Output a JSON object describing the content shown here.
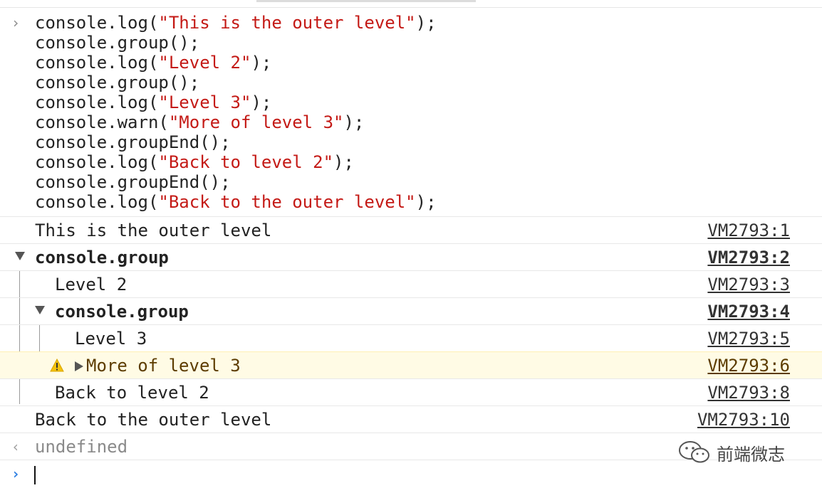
{
  "input": {
    "prompt_icon": "chevron-right-icon",
    "lines": [
      {
        "pre": "console.log(",
        "str": "\"This is the outer level\"",
        "post": ");"
      },
      {
        "pre": "console.group();",
        "str": "",
        "post": ""
      },
      {
        "pre": "console.log(",
        "str": "\"Level 2\"",
        "post": ");"
      },
      {
        "pre": "console.group();",
        "str": "",
        "post": ""
      },
      {
        "pre": "console.log(",
        "str": "\"Level 3\"",
        "post": ");"
      },
      {
        "pre": "console.warn(",
        "str": "\"More of level 3\"",
        "post": ");"
      },
      {
        "pre": "console.groupEnd();",
        "str": "",
        "post": ""
      },
      {
        "pre": "console.log(",
        "str": "\"Back to level 2\"",
        "post": ");"
      },
      {
        "pre": "console.groupEnd();",
        "str": "",
        "post": ""
      },
      {
        "pre": "console.log(",
        "str": "\"Back to the outer level\"",
        "post": ");"
      }
    ]
  },
  "messages": [
    {
      "text": "This is the outer level",
      "source": "VM2793:1"
    },
    {
      "text": "console.group",
      "source": "VM2793:2",
      "expand_icon": "triangle-down-icon"
    },
    {
      "text": "Level 2",
      "source": "VM2793:3"
    },
    {
      "text": "console.group",
      "source": "VM2793:4",
      "expand_icon": "triangle-down-icon"
    },
    {
      "text": "Level 3",
      "source": "VM2793:5"
    },
    {
      "text": "More of level 3",
      "source": "VM2793:6",
      "level_icon": "warning-icon",
      "expand_icon": "triangle-right-icon"
    },
    {
      "text": "Back to level 2",
      "source": "VM2793:8"
    },
    {
      "text": "Back to the outer level",
      "source": "VM2793:10"
    }
  ],
  "result": {
    "prompt_icon": "chevron-left-icon",
    "text": "undefined"
  },
  "new_prompt": {
    "prompt_icon": "chevron-right-icon"
  },
  "watermark": {
    "icon": "wechat-icon",
    "text": "前端微志"
  },
  "colors": {
    "string": "#c41a16",
    "warning_bg": "#fffbe5",
    "warning_text": "#5c3c00",
    "prompt_blue": "#2a7de1"
  }
}
